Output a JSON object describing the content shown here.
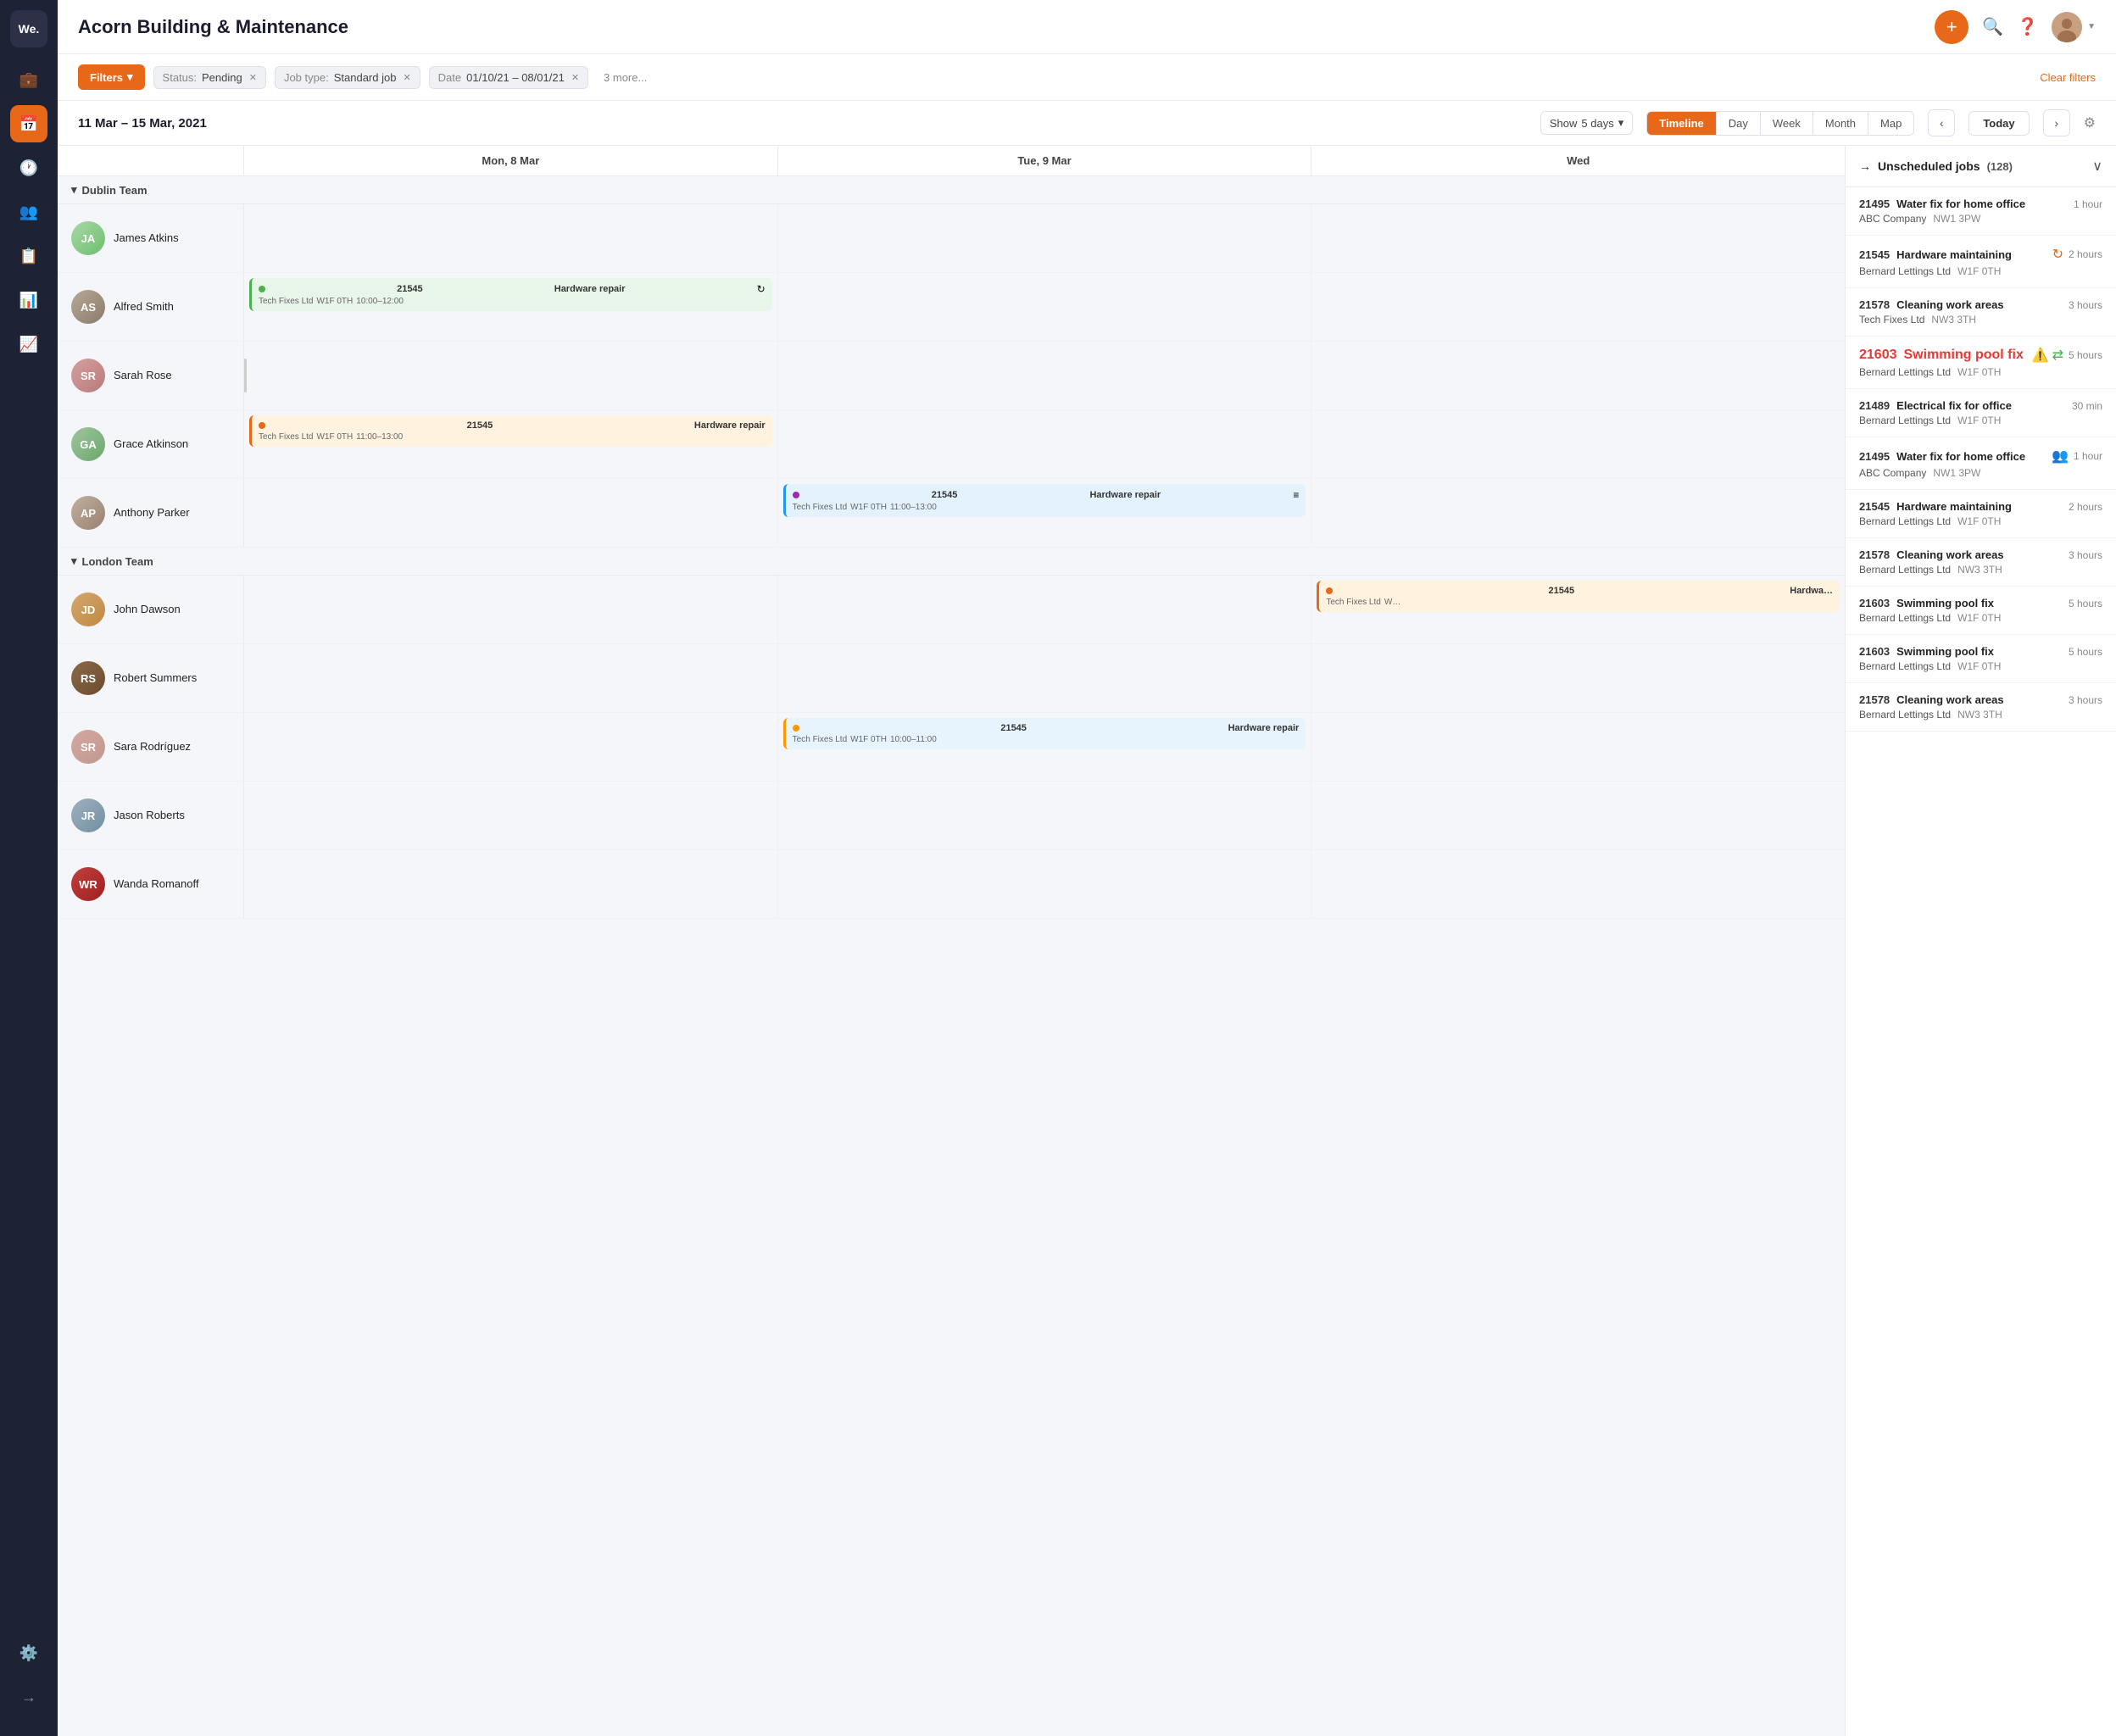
{
  "app": {
    "logo": "We.",
    "title": "Acorn Building & Maintenance"
  },
  "sidebar": {
    "icons": [
      {
        "name": "briefcase-icon",
        "symbol": "💼",
        "active": false
      },
      {
        "name": "calendar-icon",
        "symbol": "📅",
        "active": true
      },
      {
        "name": "clock-icon",
        "symbol": "🕐",
        "active": false
      },
      {
        "name": "users-icon",
        "symbol": "👥",
        "active": false
      },
      {
        "name": "list-icon",
        "symbol": "📋",
        "active": false
      },
      {
        "name": "report-icon",
        "symbol": "📊",
        "active": false
      },
      {
        "name": "chart-icon",
        "symbol": "📈",
        "active": false
      }
    ],
    "bottom_icons": [
      {
        "name": "settings-icon",
        "symbol": "⚙️",
        "active": false
      },
      {
        "name": "arrow-icon",
        "symbol": "→",
        "active": false
      }
    ]
  },
  "toolbar": {
    "filters_label": "Filters",
    "status_label": "Status:",
    "status_value": "Pending",
    "jobtype_label": "Job type:",
    "jobtype_value": "Standard job",
    "date_label": "Date",
    "date_value": "01/10/21 – 08/01/21",
    "more_label": "3 more...",
    "clear_label": "Clear filters"
  },
  "calendar": {
    "date_range": "11 Mar – 15 Mar, 2021",
    "show_label": "Show",
    "show_value": "5 days",
    "views": [
      "Timeline",
      "Day",
      "Week",
      "Month",
      "Map"
    ],
    "active_view": "Timeline",
    "today_label": "Today",
    "days": [
      {
        "label": "Mon, 8 Mar"
      },
      {
        "label": "Tue, 9 Mar"
      },
      {
        "label": "Wed"
      }
    ]
  },
  "teams": [
    {
      "name": "Dublin Team",
      "members": [
        {
          "name": "James Atkins",
          "initials": "JA",
          "av_class": "av-james",
          "jobs": [
            {
              "day": 0,
              "cards": []
            },
            {
              "day": 1,
              "cards": []
            },
            {
              "day": 2,
              "cards": []
            }
          ]
        },
        {
          "name": "Alfred Smith",
          "initials": "AS",
          "av_class": "av-alfred",
          "jobs": [
            {
              "day": 0,
              "cards": [
                {
                  "id": "21545",
                  "name": "Hardware repair",
                  "company": "Tech Fixes Ltd",
                  "location": "W1F 0TH",
                  "time": "10:00–12:00",
                  "type": "green",
                  "dot_color": "#4caf50",
                  "icon": "↻"
                }
              ]
            },
            {
              "day": 1,
              "cards": []
            },
            {
              "day": 2,
              "cards": []
            }
          ]
        },
        {
          "name": "Sarah Rose",
          "initials": "SR",
          "av_class": "av-sarah",
          "jobs": [
            {
              "day": 0,
              "cards": []
            },
            {
              "day": 1,
              "cards": []
            },
            {
              "day": 2,
              "cards": []
            }
          ]
        },
        {
          "name": "Grace Atkinson",
          "initials": "GA",
          "av_class": "av-grace",
          "jobs": [
            {
              "day": 0,
              "cards": [
                {
                  "id": "21545",
                  "name": "Hardware repair",
                  "company": "Tech Fixes Ltd",
                  "location": "W1F 0TH",
                  "time": "11:00–13:00",
                  "type": "orange",
                  "dot_color": "#e8681a",
                  "icon": ""
                }
              ]
            },
            {
              "day": 1,
              "cards": []
            },
            {
              "day": 2,
              "cards": []
            }
          ]
        },
        {
          "name": "Anthony Parker",
          "initials": "AP",
          "av_class": "av-anthony",
          "jobs": [
            {
              "day": 0,
              "cards": []
            },
            {
              "day": 1,
              "cards": [
                {
                  "id": "21545",
                  "name": "Hardware repair",
                  "company": "Tech Fixes Ltd",
                  "location": "W1F 0TH",
                  "time": "11:00–13:00",
                  "type": "blue",
                  "dot_color": "#9c27b0",
                  "icon": "≡"
                }
              ]
            },
            {
              "day": 2,
              "cards": []
            }
          ]
        }
      ]
    },
    {
      "name": "London Team",
      "members": [
        {
          "name": "John Dawson",
          "initials": "JD",
          "av_class": "av-john",
          "jobs": [
            {
              "day": 0,
              "cards": []
            },
            {
              "day": 1,
              "cards": []
            },
            {
              "day": 2,
              "cards": [
                {
                  "id": "21545",
                  "name": "Hardwa…",
                  "company": "Tech Fixes Ltd",
                  "location": "W…",
                  "time": "",
                  "type": "orange",
                  "dot_color": "#e8681a",
                  "icon": ""
                }
              ]
            }
          ]
        },
        {
          "name": "Robert Summers",
          "initials": "RS",
          "av_class": "av-robert",
          "jobs": [
            {
              "day": 0,
              "cards": []
            },
            {
              "day": 1,
              "cards": []
            },
            {
              "day": 2,
              "cards": []
            }
          ]
        },
        {
          "name": "Sara Rodríguez",
          "initials": "SR",
          "av_class": "av-sara",
          "jobs": [
            {
              "day": 0,
              "cards": []
            },
            {
              "day": 1,
              "cards": [
                {
                  "id": "21545",
                  "name": "Hardware repair",
                  "company": "Tech Fixes Ltd",
                  "location": "W1F 0TH",
                  "time": "10:00–11:00",
                  "type": "blue",
                  "dot_color": "#ff9800",
                  "icon": ""
                }
              ]
            },
            {
              "day": 2,
              "cards": []
            }
          ]
        },
        {
          "name": "Jason Roberts",
          "initials": "JR",
          "av_class": "av-jason",
          "jobs": [
            {
              "day": 0,
              "cards": []
            },
            {
              "day": 1,
              "cards": []
            },
            {
              "day": 2,
              "cards": []
            }
          ]
        },
        {
          "name": "Wanda Romanoff",
          "initials": "WR",
          "av_class": "av-wanda",
          "jobs": [
            {
              "day": 0,
              "cards": []
            },
            {
              "day": 1,
              "cards": []
            },
            {
              "day": 2,
              "cards": []
            }
          ]
        }
      ]
    }
  ],
  "unscheduled": {
    "arrow": "→",
    "title": "Unscheduled jobs",
    "count": "128",
    "chevron": "∨",
    "jobs": [
      {
        "id": "21495",
        "name": "Water fix for home office",
        "company": "ABC Company",
        "location": "NW1 3PW",
        "duration": "1 hour",
        "icon": "",
        "red": false
      },
      {
        "id": "21545",
        "name": "Hardware maintaining",
        "company": "Bernard Lettings Ltd",
        "location": "W1F 0TH",
        "duration": "2 hours",
        "icon": "↻",
        "red": false
      },
      {
        "id": "21578",
        "name": "Cleaning work areas",
        "company": "Tech Fixes Ltd",
        "location": "NW3 3TH",
        "duration": "3 hours",
        "icon": "",
        "red": false
      },
      {
        "id": "21603",
        "name": "Swimming pool fix",
        "company": "Bernard Lettings Ltd",
        "location": "W1F 0TH",
        "duration": "5 hours",
        "icon": "⚠️",
        "red": true
      },
      {
        "id": "21489",
        "name": "Electrical fix for office",
        "company": "Bernard Lettings Ltd",
        "location": "W1F 0TH",
        "duration": "30 min",
        "icon": "",
        "red": false
      },
      {
        "id": "21495",
        "name": "Water fix for home office",
        "company": "ABC Company",
        "location": "NW1 3PW",
        "duration": "1 hour",
        "icon": "👥",
        "red": false
      },
      {
        "id": "21545",
        "name": "Hardware maintaining",
        "company": "Bernard Lettings Ltd",
        "location": "W1F 0TH",
        "duration": "2 hours",
        "icon": "",
        "red": false
      },
      {
        "id": "21578",
        "name": "Cleaning work areas",
        "company": "Bernard Lettings Ltd",
        "location": "NW3 3TH",
        "duration": "3 hours",
        "icon": "",
        "red": false
      },
      {
        "id": "21603",
        "name": "Swimming pool fix",
        "company": "Bernard Lettings Ltd",
        "location": "W1F 0TH",
        "duration": "5 hours",
        "icon": "",
        "red": false
      },
      {
        "id": "21603",
        "name": "Swimming pool fix",
        "company": "Bernard Lettings Ltd",
        "location": "W1F 0TH",
        "duration": "5 hours",
        "icon": "",
        "red": false
      },
      {
        "id": "21578",
        "name": "Cleaning work areas",
        "company": "Bernard Lettings Ltd",
        "location": "NW3 3TH",
        "duration": "3 hours",
        "icon": "",
        "red": false
      }
    ]
  }
}
